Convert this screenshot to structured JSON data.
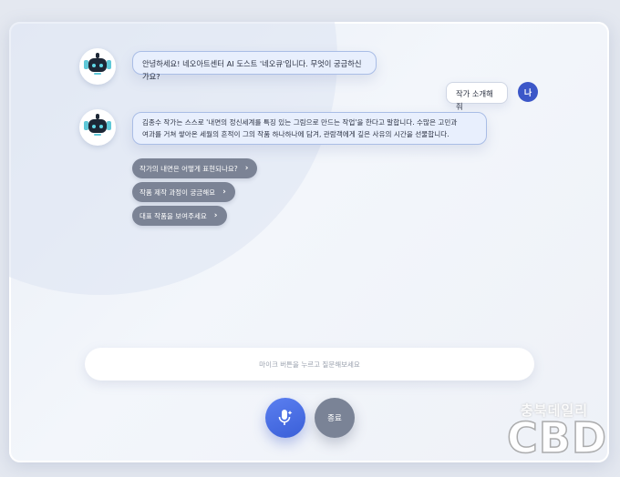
{
  "chat": {
    "messages": [
      {
        "role": "bot",
        "text": "안녕하세요! 네오아트센터 AI 도스트 '네오큐'입니다. 무엇이 궁금하신가요?"
      },
      {
        "role": "user",
        "text": "작가 소개해줘",
        "avatar_initial": "나"
      },
      {
        "role": "bot",
        "line1": "김종수 작가는 스스로 '내면의 정신세계를 특징 있는 그림으로 만드는 작업'을 한다고 말합니다. 수많은 고민과",
        "line2": "여과를 거쳐 쌓아온 세월의 흔적이 그의 작품 하나하나에 담겨, 관람객에게 깊은 사유의 시간을 선물합니다."
      }
    ],
    "suggestions": [
      {
        "label": "작가의 내면은 어떻게 표현되나요?"
      },
      {
        "label": "작품 제작 과정이 궁금해요"
      },
      {
        "label": "대표 작품을 보여주세요"
      }
    ]
  },
  "input": {
    "placeholder": "마이크 버튼을 누르고 질문해보세요"
  },
  "controls": {
    "end_label": "종료"
  },
  "watermark": {
    "korean": "충북데일리",
    "brand": "CBD"
  },
  "colors": {
    "accent": "#3a5fd8",
    "bubble": "#e8effd",
    "chip": "#7b8395"
  }
}
